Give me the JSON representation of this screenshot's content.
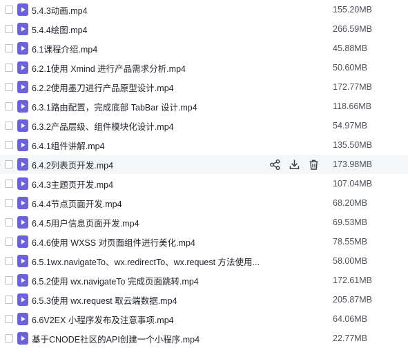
{
  "files": [
    {
      "name": "5.4.3动画.mp4",
      "size": "155.20MB"
    },
    {
      "name": "5.4.4绘图.mp4",
      "size": "266.59MB"
    },
    {
      "name": "6.1课程介绍.mp4",
      "size": "45.88MB"
    },
    {
      "name": "6.2.1使用 Xmind 进行产品需求分析.mp4",
      "size": "50.60MB"
    },
    {
      "name": "6.2.2使用墨刀进行产品原型设计.mp4",
      "size": "172.77MB"
    },
    {
      "name": "6.3.1路由配置，完成底部 TabBar 设计.mp4",
      "size": "118.66MB"
    },
    {
      "name": "6.3.2产品层级、组件模块化设计.mp4",
      "size": "54.97MB"
    },
    {
      "name": "6.4.1组件讲解.mp4",
      "size": "135.50MB"
    },
    {
      "name": "6.4.2列表页开发.mp4",
      "size": "173.98MB"
    },
    {
      "name": "6.4.3主题页开发.mp4",
      "size": "107.04MB"
    },
    {
      "name": "6.4.4节点页面开发.mp4",
      "size": "68.20MB"
    },
    {
      "name": "6.4.5用户信息页面开发.mp4",
      "size": "69.53MB"
    },
    {
      "name": "6.4.6使用 WXSS 对页面组件进行美化.mp4",
      "size": "78.55MB"
    },
    {
      "name": "6.5.1wx.navigateTo、wx.redirectTo、wx.request 方法使用...",
      "size": "58.00MB"
    },
    {
      "name": "6.5.2使用 wx.navigateTo 完成页面跳转.mp4",
      "size": "172.61MB"
    },
    {
      "name": "6.5.3使用 wx.request 取云端数据.mp4",
      "size": "205.87MB"
    },
    {
      "name": "6.6V2EX 小程序发布及注意事项.mp4",
      "size": "64.06MB"
    },
    {
      "name": "基于CNODE社区的API创建一个小程序.mp4",
      "size": "22.77MB"
    }
  ],
  "hovered_row_index": 8,
  "row_actions": [
    "share-icon",
    "download-icon",
    "delete-icon"
  ],
  "colors": {
    "file_icon": "#6c63d9",
    "hover_bg": "#f5f6f8"
  }
}
